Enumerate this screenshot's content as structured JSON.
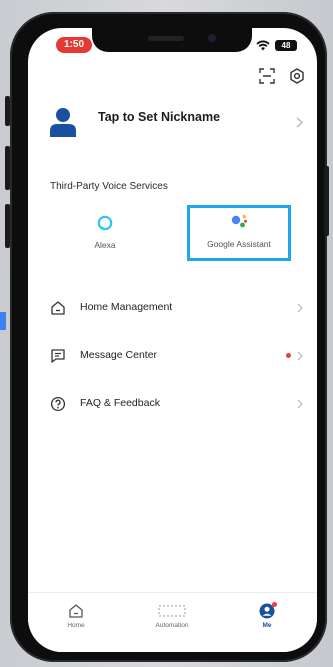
{
  "status_bar": {
    "time": "1:50",
    "battery": "48"
  },
  "profile": {
    "nickname_prompt": "Tap to Set Nickname"
  },
  "voice_services": {
    "title": "Third-Party Voice Services",
    "items": [
      {
        "name": "Alexa"
      },
      {
        "name": "Google Assistant",
        "highlighted": true
      }
    ]
  },
  "menu": {
    "items": [
      {
        "label": "Home Management",
        "icon": "house-icon"
      },
      {
        "label": "Message Center",
        "icon": "message-icon",
        "has_unread": true
      },
      {
        "label": "FAQ & Feedback",
        "icon": "question-icon"
      }
    ]
  },
  "tabbar": {
    "tabs": [
      {
        "label": "Home"
      },
      {
        "label": "Automation"
      },
      {
        "label": "Me",
        "active": true
      }
    ]
  },
  "colors": {
    "accent": "#1b4fa0",
    "highlight_border": "#1ea6f0",
    "notification": "#ef3b3b",
    "status_time_pill": "#e53935"
  }
}
